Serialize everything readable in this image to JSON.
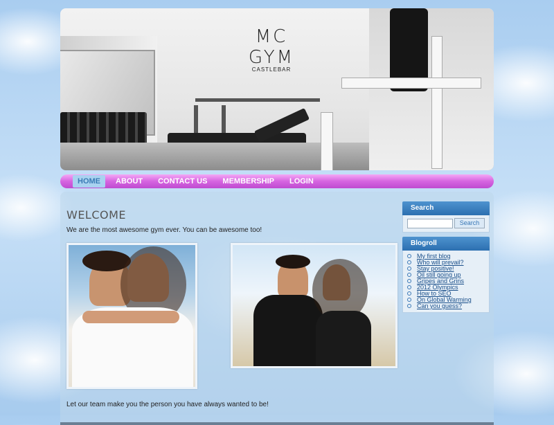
{
  "logo": {
    "line1": "MC",
    "line2": "GYM",
    "line3": "CASTLEBAR"
  },
  "nav": {
    "items": [
      {
        "label": "HOME",
        "active": true
      },
      {
        "label": "ABOUT",
        "active": false
      },
      {
        "label": "CONTACT US",
        "active": false
      },
      {
        "label": "MEMBERSHIP",
        "active": false
      },
      {
        "label": "LOGIN",
        "active": false
      }
    ]
  },
  "main": {
    "title": "WELCOME",
    "intro": "We are the most awesome gym ever. You can be awesome too!",
    "outro": "Let our team make you the person you have always wanted to be!"
  },
  "sidebar": {
    "search": {
      "title": "Search",
      "placeholder": "",
      "button": "Search"
    },
    "blogroll": {
      "title": "Blogroll",
      "items": [
        "My first blog",
        "Who will prevail?",
        "Stay positive!",
        "Oil still going up",
        "Gripes and Grins",
        "2012 Olympics",
        "How to SEO",
        "On Global Warming",
        "Can you guess?"
      ]
    }
  },
  "colors": {
    "nav_gradient_top": "#f3a8f5",
    "nav_gradient_bottom": "#bf4bd0",
    "active_tab_bg": "#a9d2f0",
    "box_header": "#2c6fb0",
    "link": "#1a4f8a"
  }
}
